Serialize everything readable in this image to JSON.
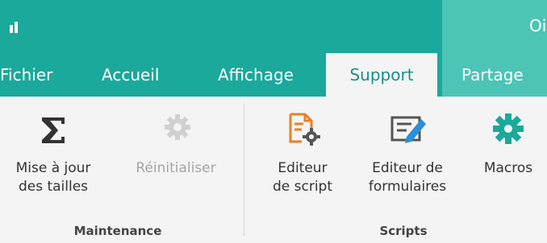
{
  "window": {
    "title": "Oi"
  },
  "tabs": [
    {
      "label": "Fichier"
    },
    {
      "label": "Accueil"
    },
    {
      "label": "Affichage"
    },
    {
      "label": "Support",
      "active": true
    },
    {
      "label": "Partage"
    }
  ],
  "groups": {
    "maintenance": {
      "label": "Maintenance",
      "buttons": {
        "update_sizes": {
          "line1": "Mise à jour",
          "line2": "des tailles",
          "icon": "sigma-icon"
        },
        "reset": {
          "line1": "Réinitialiser",
          "icon": "gear-icon",
          "disabled": true
        }
      }
    },
    "scripts": {
      "label": "Scripts",
      "buttons": {
        "script_editor": {
          "line1": "Editeur",
          "line2": "de script",
          "icon": "script-editor-icon"
        },
        "form_editor": {
          "line1": "Editeur de",
          "line2": "formulaires",
          "icon": "form-editor-icon"
        },
        "macros": {
          "line1": "Macros",
          "icon": "gear-icon"
        }
      }
    }
  },
  "colors": {
    "titlebar": "#1aa99b",
    "titlebar_light": "#4cc4b6",
    "active_tab_text": "#1a8f84",
    "ribbon_bg": "#f4f4f4",
    "script_icon_orange": "#e8802a",
    "form_icon_blue": "#2b8fd8",
    "macros_icon_teal": "#1aa99b"
  }
}
